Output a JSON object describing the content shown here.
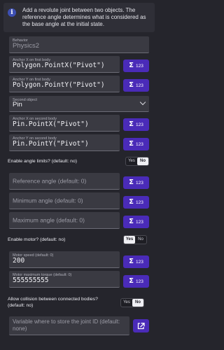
{
  "description": "Add a revolute joint between two objects. The reference angle determines what is considered as the base angle at the initial state.",
  "behavior": {
    "label": "Behavior",
    "value": "Physics2"
  },
  "anchor_x_first": {
    "label": "Anchor X on first body",
    "value": "Polygon.PointX(\"Pivot\")"
  },
  "anchor_y_first": {
    "label": "Anchor Y on first body",
    "value": "Polygon.PointY(\"Pivot\")"
  },
  "second_object": {
    "label": "Second object",
    "value": "Pin"
  },
  "anchor_x_second": {
    "label": "Anchor X on second body",
    "value": "Pin.PointX(\"Pivot\")"
  },
  "anchor_y_second": {
    "label": "Anchor Y on second body",
    "value": "Pin.PointY(\"Pivot\")"
  },
  "expr_button": {
    "symbol": "Σ",
    "label": "123"
  },
  "enable_angle_limits": {
    "label": "Enable angle limits? (default: no)",
    "yes": "Yes",
    "no": "No",
    "selected": "no"
  },
  "reference_angle": {
    "placeholder": "Reference angle (default: 0)"
  },
  "minimum_angle": {
    "placeholder": "Minimum angle (default: 0)"
  },
  "maximum_angle": {
    "placeholder": "Maximum angle (default: 0)"
  },
  "enable_motor": {
    "label": "Enable motor? (default: no)",
    "yes": "Yes",
    "no": "No",
    "selected": "yes"
  },
  "motor_speed": {
    "label": "Motor speed (default: 0)",
    "value": "200"
  },
  "motor_max_torque": {
    "label": "Motor maximum torque (default: 0)",
    "value": "555555555"
  },
  "allow_collision": {
    "label_line1": "Allow collision between connected bodies?",
    "label_line2": "(default: no)",
    "yes": "Yes",
    "no": "No",
    "selected": "no"
  },
  "joint_id_variable": {
    "placeholder_line1": "Variable where to store the joint ID (default:",
    "placeholder_line2": "none)"
  },
  "colors": {
    "accent": "#4a2bb8",
    "info": "#3d4fb2",
    "background": "#25252c"
  },
  "icons": {
    "info": "info-icon",
    "expression": "sigma-icon",
    "dropdown": "chevron-down-icon",
    "open": "external-link-icon"
  }
}
